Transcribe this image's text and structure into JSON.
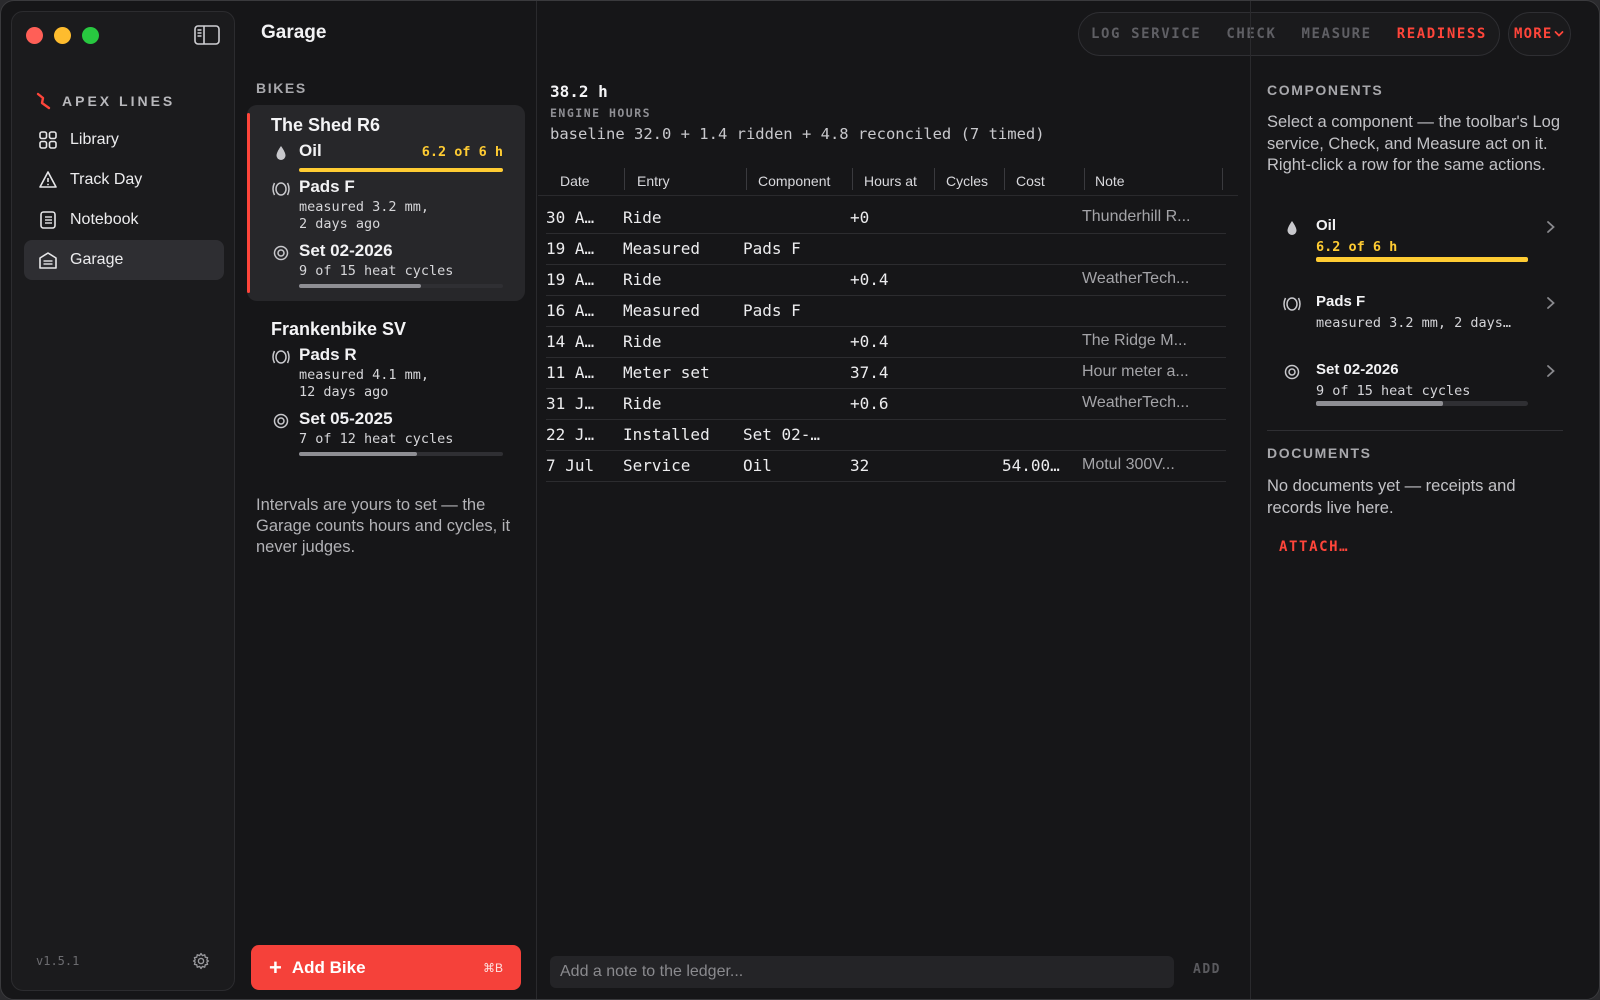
{
  "app": {
    "brand": "APEX LINES",
    "version": "v1.5.1",
    "page_title": "Garage"
  },
  "colors": {
    "accent": "#ff453a",
    "warning": "#ffcc33",
    "bar_neutral": "#8e8e93"
  },
  "nav": [
    {
      "label": "Library",
      "icon": "grid-icon"
    },
    {
      "label": "Track Day",
      "icon": "track-icon"
    },
    {
      "label": "Notebook",
      "icon": "notebook-icon"
    },
    {
      "label": "Garage",
      "icon": "garage-icon",
      "active": true
    }
  ],
  "toolbar": {
    "log_service": "LOG SERVICE",
    "check": "CHECK",
    "measure": "MEASURE",
    "readiness": "READINESS",
    "more": "MORE"
  },
  "bikes": {
    "label": "BIKES",
    "items": [
      {
        "name": "The Shed R6",
        "selected": true,
        "oil": {
          "title": "Oil",
          "value": "6.2 of 6 h",
          "progress": 1.0
        },
        "pads": {
          "title": "Pads F",
          "line1": "measured 3.2 mm,",
          "line2": "2 days ago"
        },
        "tires": {
          "title": "Set 02-2026",
          "sub": "9 of 15 heat cycles",
          "progress": 0.6
        }
      },
      {
        "name": "Frankenbike SV",
        "selected": false,
        "pads": {
          "title": "Pads R",
          "line1": "measured 4.1 mm,",
          "line2": "12 days ago"
        },
        "tires": {
          "title": "Set 05-2025",
          "sub": "7 of 12 heat cycles",
          "progress": 0.58
        }
      }
    ],
    "hint": "Intervals are yours to set — the Garage counts hours and cycles, it never judges.",
    "add_button": "Add Bike",
    "add_shortcut": "⌘B"
  },
  "engine": {
    "hours": "38.2 h",
    "label": "ENGINE HOURS",
    "formula": "baseline 32.0 + 1.4 ridden + 4.8 reconciled (7 timed)"
  },
  "ledger": {
    "columns": [
      "Date",
      "Entry",
      "Component",
      "Hours at",
      "Cycles",
      "Cost",
      "Note"
    ],
    "rows": [
      {
        "date": "30 A…",
        "entry": "Ride",
        "component": "",
        "hours": "+0",
        "cycles": "",
        "cost": "",
        "note": "Thunderhill R..."
      },
      {
        "date": "19 A…",
        "entry": "Measured",
        "component": "Pads F",
        "hours": "",
        "cycles": "",
        "cost": "",
        "note": ""
      },
      {
        "date": "19 A…",
        "entry": "Ride",
        "component": "",
        "hours": "+0.4",
        "cycles": "",
        "cost": "",
        "note": "WeatherTech..."
      },
      {
        "date": "16 A…",
        "entry": "Measured",
        "component": "Pads F",
        "hours": "",
        "cycles": "",
        "cost": "",
        "note": ""
      },
      {
        "date": "14 A…",
        "entry": "Ride",
        "component": "",
        "hours": "+0.4",
        "cycles": "",
        "cost": "",
        "note": "The Ridge M..."
      },
      {
        "date": "11 A…",
        "entry": "Meter set",
        "component": "",
        "hours": "37.4",
        "cycles": "",
        "cost": "",
        "note": "Hour meter a..."
      },
      {
        "date": "31 J…",
        "entry": "Ride",
        "component": "",
        "hours": "+0.6",
        "cycles": "",
        "cost": "",
        "note": "WeatherTech..."
      },
      {
        "date": "22 J…",
        "entry": "Installed",
        "component": "Set 02-…",
        "hours": "",
        "cycles": "",
        "cost": "",
        "note": ""
      },
      {
        "date": "7 Jul",
        "entry": "Service",
        "component": "Oil",
        "hours": "32",
        "cycles": "",
        "cost": "54.00…",
        "note": "Motul 300V..."
      }
    ],
    "note_placeholder": "Add a note to the ledger...",
    "add_label": "ADD"
  },
  "components_panel": {
    "label": "COMPONENTS",
    "description": "Select a component — the toolbar's Log service, Check, and Measure act on it. Right-click a row for the same actions.",
    "items": [
      {
        "title": "Oil",
        "sub": "6.2 of 6 h",
        "progress": 1.0
      },
      {
        "title": "Pads F",
        "sub": "measured 3.2 mm, 2 days…"
      },
      {
        "title": "Set 02-2026",
        "sub": "9 of 15 heat cycles",
        "progress": 0.6
      }
    ]
  },
  "documents": {
    "label": "DOCUMENTS",
    "text": "No documents yet — receipts and records live here.",
    "attach": "ATTACH…"
  }
}
